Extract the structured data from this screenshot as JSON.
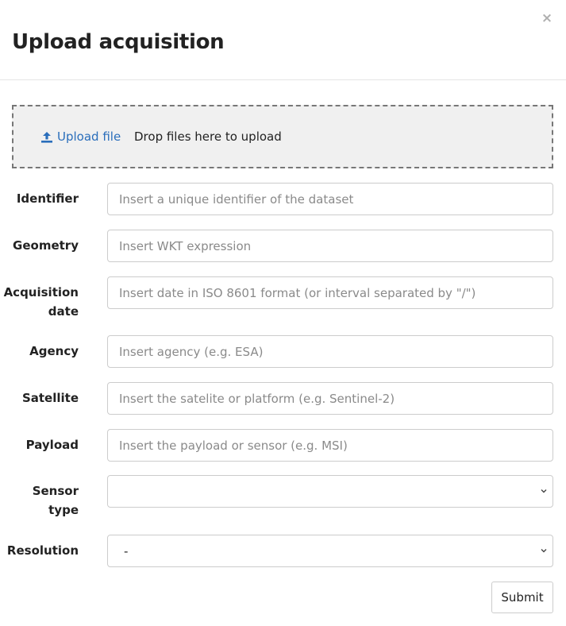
{
  "dialog": {
    "title": "Upload acquisition",
    "close_glyph": "×"
  },
  "dropzone": {
    "upload_link": "Upload file",
    "drop_text": "Drop files here to upload"
  },
  "fields": {
    "identifier": {
      "label": "Identifier",
      "placeholder": "Insert a unique identifier of the dataset",
      "value": ""
    },
    "geometry": {
      "label": "Geometry",
      "placeholder": "Insert WKT expression",
      "value": ""
    },
    "acquisition_date": {
      "label_line1": "Acquisition",
      "label_line2": "date",
      "placeholder": "Insert date in ISO 8601 format (or interval separated by \"/\")",
      "value": ""
    },
    "agency": {
      "label": "Agency",
      "placeholder": "Insert agency (e.g. ESA)",
      "value": ""
    },
    "satellite": {
      "label": "Satellite",
      "placeholder": "Insert the satelite or platform (e.g. Sentinel-2)",
      "value": ""
    },
    "payload": {
      "label": "Payload",
      "placeholder": "Insert the payload or sensor (e.g. MSI)",
      "value": ""
    },
    "sensor_type": {
      "label_line1": "Sensor",
      "label_line2": "type",
      "selected": ""
    },
    "resolution": {
      "label": "Resolution",
      "selected": "-"
    }
  },
  "actions": {
    "submit_label": "Submit"
  },
  "colors": {
    "link": "#2a6ebb",
    "dropzone_bg": "#f0f0f0",
    "dropzone_border": "#777777",
    "input_border": "#cccccc"
  },
  "icons": {
    "close": "close-icon",
    "upload": "upload-icon",
    "select_arrow": "chevron-down-icon"
  }
}
